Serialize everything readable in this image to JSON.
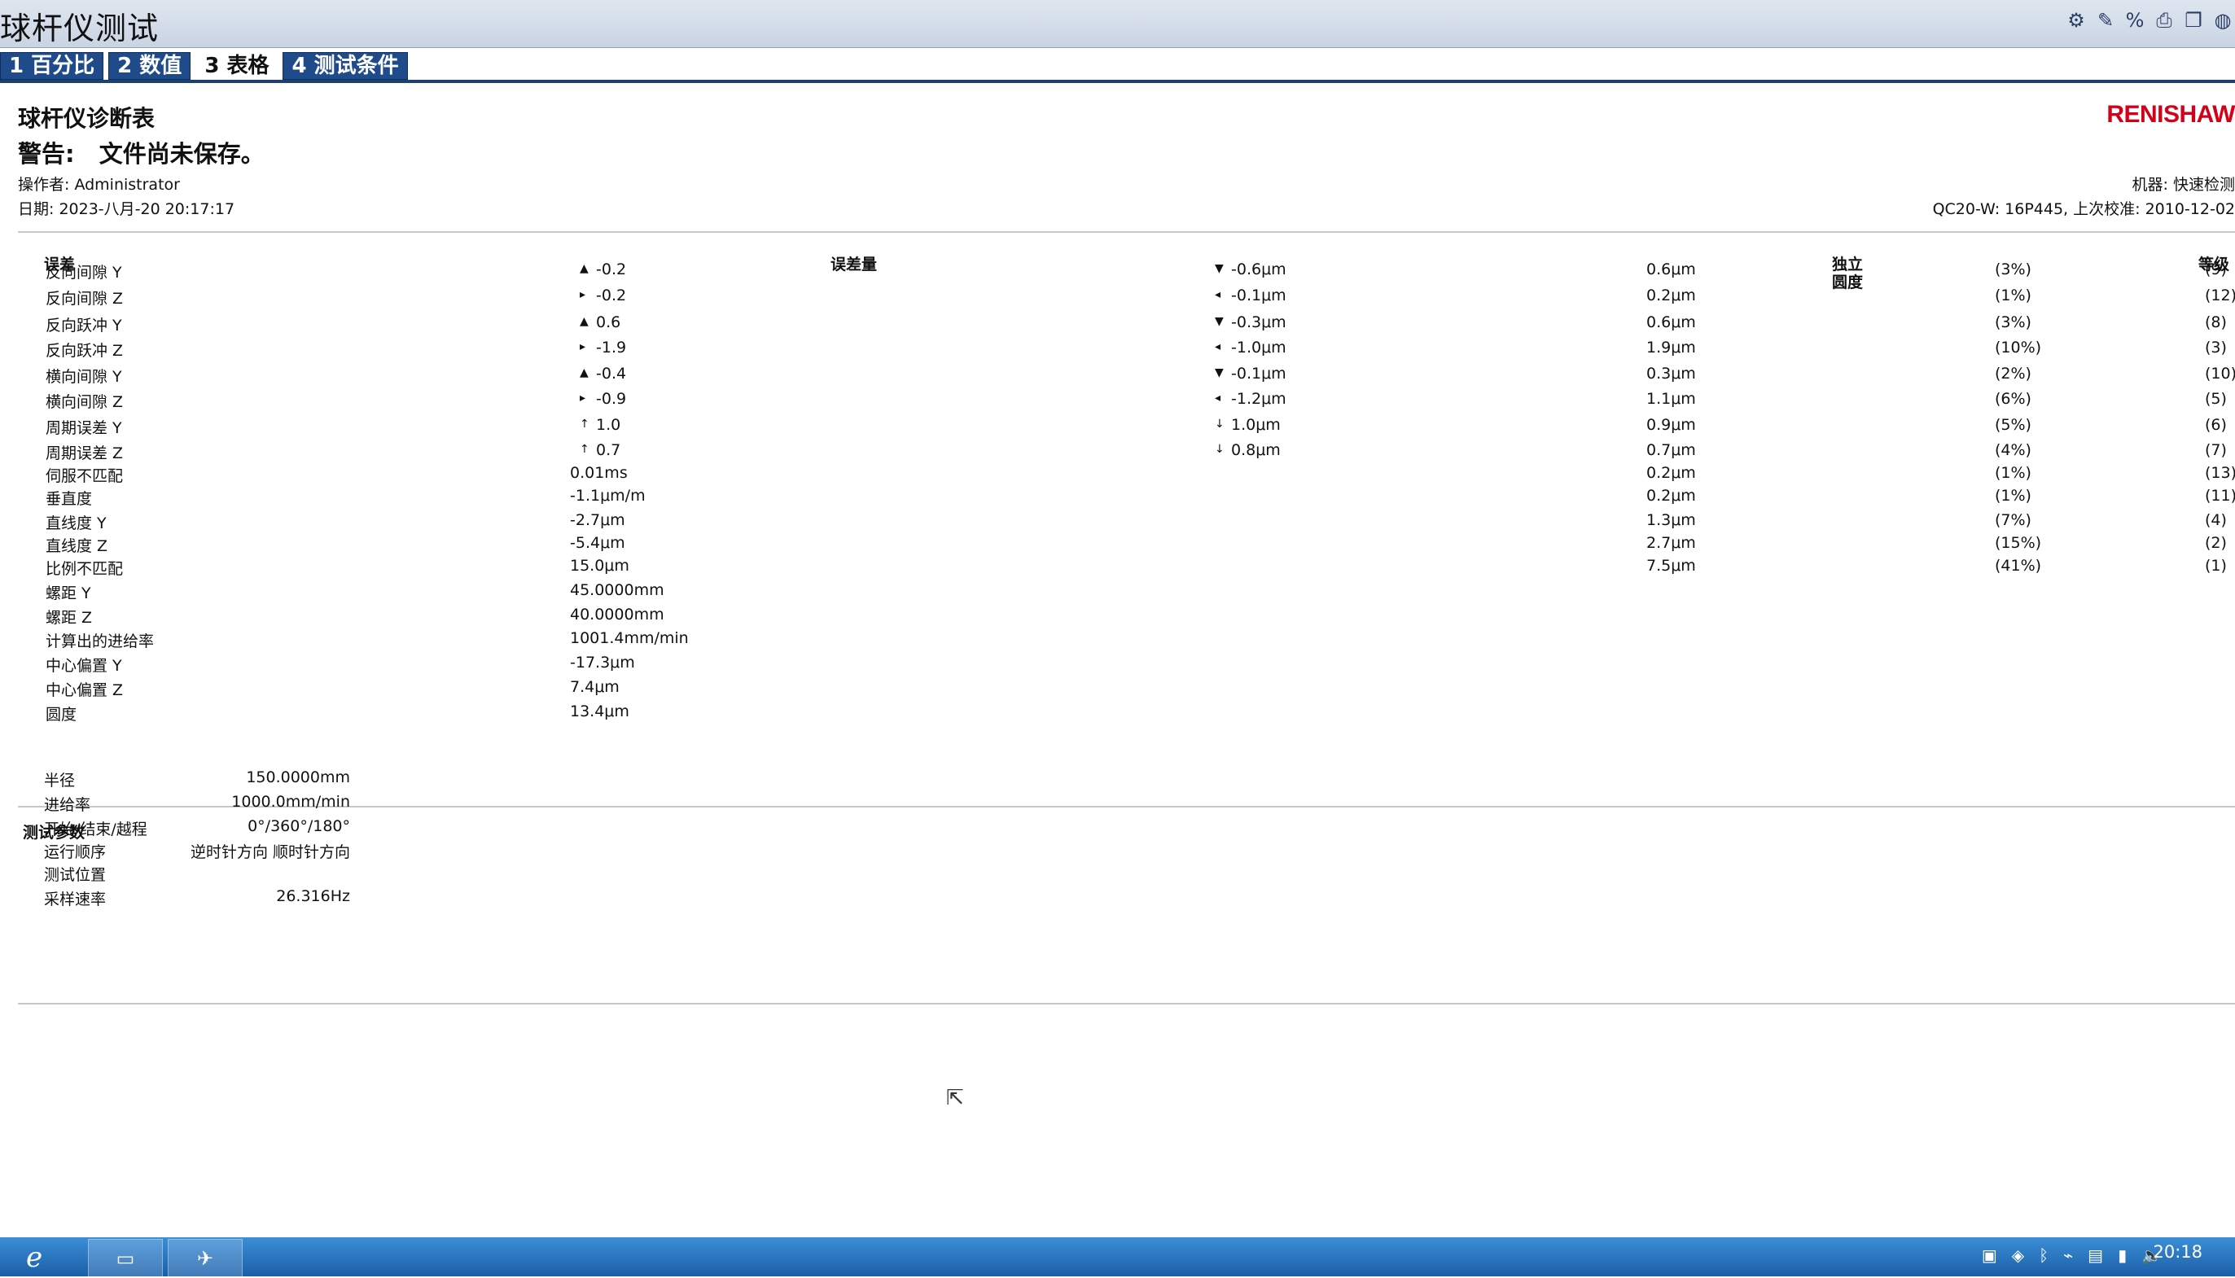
{
  "app": {
    "title": "球杆仪测试"
  },
  "tabs": [
    "1 百分比",
    "2 数值",
    "3 表格",
    "4 测试条件"
  ],
  "toolbar_icons": [
    "settings-icon",
    "pen-icon",
    "percent-icon",
    "print-icon",
    "copy-icon",
    "globe-icon"
  ],
  "report": {
    "title": "球杆仪诊断表",
    "warning_label": "警告:",
    "warning_text": "文件尚未保存。",
    "operator": "操作者: Administrator",
    "date": "日期: 2023-八月-20 20:17:17",
    "logo": "RENISHAW",
    "machine": "机器: 快速检测",
    "device": "QC20-W: 16P445, 上次校准: 2010-12-02"
  },
  "table": {
    "headers": {
      "error": "误差",
      "magnitude": "误差量",
      "independent": "独立",
      "roundness": "圆度",
      "rank": "等级"
    },
    "rows": [
      {
        "name": "反向间隙 Y",
        "v1_arrow": "▲",
        "v1": "-0.2",
        "v2_arrow": "▼",
        "v2": "-0.6μm",
        "v3": "0.6μm",
        "pct": "(3%)",
        "rank": "(9)"
      },
      {
        "name": "反向间隙 Z",
        "v1_arrow": "▸",
        "v1": "-0.2",
        "v2_arrow": "◂",
        "v2": "-0.1μm",
        "v3": "0.2μm",
        "pct": "(1%)",
        "rank": "(12)"
      },
      {
        "name": "反向跃冲 Y",
        "v1_arrow": "▲",
        "v1": "0.6",
        "v2_arrow": "▼",
        "v2": "-0.3μm",
        "v3": "0.6μm",
        "pct": "(3%)",
        "rank": "(8)"
      },
      {
        "name": "反向跃冲 Z",
        "v1_arrow": "▸",
        "v1": "-1.9",
        "v2_arrow": "◂",
        "v2": "-1.0μm",
        "v3": "1.9μm",
        "pct": "(10%)",
        "rank": "(3)"
      },
      {
        "name": "横向间隙 Y",
        "v1_arrow": "▲",
        "v1": "-0.4",
        "v2_arrow": "▼",
        "v2": "-0.1μm",
        "v3": "0.3μm",
        "pct": "(2%)",
        "rank": "(10)"
      },
      {
        "name": "横向间隙 Z",
        "v1_arrow": "▸",
        "v1": "-0.9",
        "v2_arrow": "◂",
        "v2": "-1.2μm",
        "v3": "1.1μm",
        "pct": "(6%)",
        "rank": "(5)"
      },
      {
        "name": "周期误差 Y",
        "v1_arrow": "↑",
        "v1": "1.0",
        "v2_arrow": "↓",
        "v2": "1.0μm",
        "v3": "0.9μm",
        "pct": "(5%)",
        "rank": "(6)"
      },
      {
        "name": "周期误差 Z",
        "v1_arrow": "↑",
        "v1": "0.7",
        "v2_arrow": "↓",
        "v2": "0.8μm",
        "v3": "0.7μm",
        "pct": "(4%)",
        "rank": "(7)"
      },
      {
        "name": "伺服不匹配",
        "v1_arrow": "",
        "v1": "0.01ms",
        "v2_arrow": "",
        "v2": "",
        "v3": "0.2μm",
        "pct": "(1%)",
        "rank": "(13)"
      },
      {
        "name": "垂直度",
        "v1_arrow": "",
        "v1": "-1.1μm/m",
        "v2_arrow": "",
        "v2": "",
        "v3": "0.2μm",
        "pct": "(1%)",
        "rank": "(11)"
      },
      {
        "name": "直线度 Y",
        "v1_arrow": "",
        "v1": "-2.7μm",
        "v2_arrow": "",
        "v2": "",
        "v3": "1.3μm",
        "pct": "(7%)",
        "rank": "(4)"
      },
      {
        "name": "直线度 Z",
        "v1_arrow": "",
        "v1": "-5.4μm",
        "v2_arrow": "",
        "v2": "",
        "v3": "2.7μm",
        "pct": "(15%)",
        "rank": "(2)"
      },
      {
        "name": "比例不匹配",
        "v1_arrow": "",
        "v1": "15.0μm",
        "v2_arrow": "",
        "v2": "",
        "v3": "7.5μm",
        "pct": "(41%)",
        "rank": "(1)"
      },
      {
        "name": "螺距 Y",
        "v1_arrow": "",
        "v1": "45.0000mm",
        "v2_arrow": "",
        "v2": "",
        "v3": "",
        "pct": "",
        "rank": ""
      },
      {
        "name": "螺距 Z",
        "v1_arrow": "",
        "v1": "40.0000mm",
        "v2_arrow": "",
        "v2": "",
        "v3": "",
        "pct": "",
        "rank": ""
      },
      {
        "name": "计算出的进给率",
        "v1_arrow": "",
        "v1": "1001.4mm/min",
        "v2_arrow": "",
        "v2": "",
        "v3": "",
        "pct": "",
        "rank": ""
      },
      {
        "name": "中心偏置 Y",
        "v1_arrow": "",
        "v1": "-17.3μm",
        "v2_arrow": "",
        "v2": "",
        "v3": "",
        "pct": "",
        "rank": ""
      },
      {
        "name": "中心偏置 Z",
        "v1_arrow": "",
        "v1": "7.4μm",
        "v2_arrow": "",
        "v2": "",
        "v3": "",
        "pct": "",
        "rank": ""
      },
      {
        "name": "圆度",
        "v1_arrow": "",
        "v1": "13.4μm",
        "v2_arrow": "",
        "v2": "",
        "v3": "",
        "pct": "",
        "rank": ""
      }
    ]
  },
  "params": {
    "title": "测试参数",
    "rows": [
      {
        "label": "半径",
        "value": "150.0000mm"
      },
      {
        "label": "进给率",
        "value": "1000.0mm/min"
      },
      {
        "label": "开始/结束/越程",
        "value": "0°/360°/180°"
      },
      {
        "label": "运行顺序",
        "value": "逆时针方向 顺时针方向"
      },
      {
        "label": "测试位置",
        "value": ""
      },
      {
        "label": "采样速率",
        "value": "26.316Hz"
      }
    ]
  },
  "taskbar": {
    "start_icon": "ie-icon",
    "clock": "20:18"
  }
}
